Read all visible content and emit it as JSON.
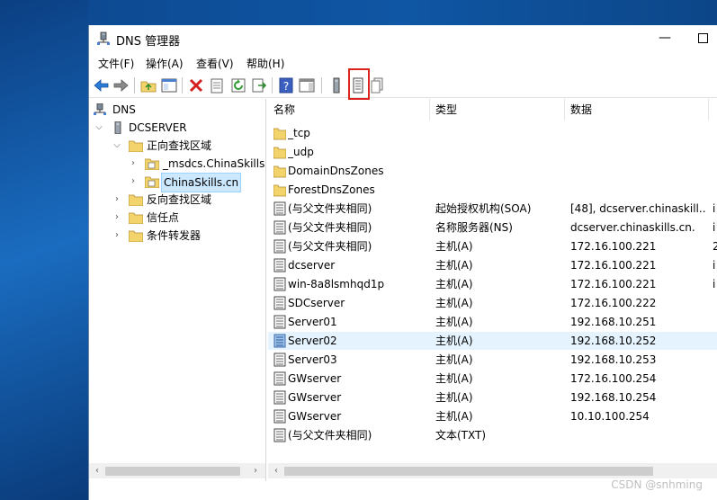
{
  "window": {
    "title": "DNS 管理器",
    "min_glyph": "—"
  },
  "menu": [
    {
      "name": "menu-file",
      "label": "文件(F)"
    },
    {
      "name": "menu-action",
      "label": "操作(A)"
    },
    {
      "name": "menu-view",
      "label": "查看(V)"
    },
    {
      "name": "menu-help",
      "label": "帮助(H)"
    }
  ],
  "tree": {
    "root": "DNS",
    "server": "DCSERVER",
    "forward": "正向查找区域",
    "msdcs": "_msdcs.ChinaSkills.cn",
    "zone": "ChinaSkills.cn",
    "reverse": "反向查找区域",
    "trust": "信任点",
    "forwarders": "条件转发器"
  },
  "columns": {
    "name": "名称",
    "type": "类型",
    "data": "数据"
  },
  "rows": [
    {
      "name": "_tcp",
      "type": "",
      "data": "",
      "extra": "",
      "icon": "folder"
    },
    {
      "name": "_udp",
      "type": "",
      "data": "",
      "extra": "",
      "icon": "folder"
    },
    {
      "name": "DomainDnsZones",
      "type": "",
      "data": "",
      "extra": "",
      "icon": "folder"
    },
    {
      "name": "ForestDnsZones",
      "type": "",
      "data": "",
      "extra": "",
      "icon": "folder"
    },
    {
      "name": "(与父文件夹相同)",
      "type": "起始授权机构(SOA)",
      "data": "[48], dcserver.chinaskill...",
      "extra": "i",
      "icon": "record"
    },
    {
      "name": "(与父文件夹相同)",
      "type": "名称服务器(NS)",
      "data": "dcserver.chinaskills.cn.",
      "extra": "i",
      "icon": "record"
    },
    {
      "name": "(与父文件夹相同)",
      "type": "主机(A)",
      "data": "172.16.100.221",
      "extra": "2",
      "icon": "record"
    },
    {
      "name": "dcserver",
      "type": "主机(A)",
      "data": "172.16.100.221",
      "extra": "i",
      "icon": "record"
    },
    {
      "name": "win-8a8lsmhqd1p",
      "type": "主机(A)",
      "data": "172.16.100.221",
      "extra": "i",
      "icon": "record"
    },
    {
      "name": "SDCserver",
      "type": "主机(A)",
      "data": "172.16.100.222",
      "extra": "",
      "icon": "record"
    },
    {
      "name": "Server01",
      "type": "主机(A)",
      "data": "192.168.10.251",
      "extra": "",
      "icon": "record"
    },
    {
      "name": "Server02",
      "type": "主机(A)",
      "data": "192.168.10.252",
      "extra": "",
      "icon": "record-sel"
    },
    {
      "name": "Server03",
      "type": "主机(A)",
      "data": "192.168.10.253",
      "extra": "",
      "icon": "record"
    },
    {
      "name": "GWserver",
      "type": "主机(A)",
      "data": "172.16.100.254",
      "extra": "",
      "icon": "record"
    },
    {
      "name": "GWserver",
      "type": "主机(A)",
      "data": "192.168.10.254",
      "extra": "",
      "icon": "record"
    },
    {
      "name": "GWserver",
      "type": "主机(A)",
      "data": "10.10.100.254",
      "extra": "",
      "icon": "record"
    },
    {
      "name": "(与父文件夹相同)",
      "type": "文本(TXT)",
      "data": "",
      "extra": "",
      "icon": "record"
    }
  ],
  "scroll": {
    "left": "‹",
    "right": "›"
  },
  "watermark": "CSDN @snhming",
  "colors": {
    "highlight_box": "#d9251d",
    "selection": "#cce8ff",
    "folder": "#f3d36b"
  }
}
